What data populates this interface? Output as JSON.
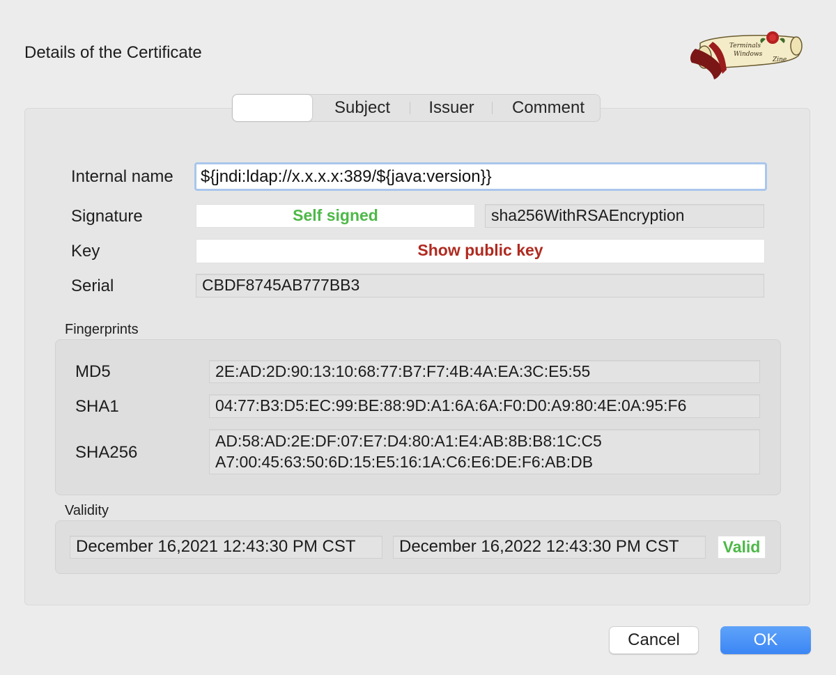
{
  "dialog": {
    "title": "Details of the Certificate"
  },
  "logo": {
    "text_line1": "Terminals",
    "text_line2": "Windows",
    "text_line3": "Zine"
  },
  "tabs": [
    {
      "label": "",
      "active": true
    },
    {
      "label": "Subject",
      "active": false
    },
    {
      "label": "Issuer",
      "active": false
    },
    {
      "label": "Comment",
      "active": false
    }
  ],
  "form": {
    "internal_name_label": "Internal name",
    "internal_name_value": "${jndi:ldap://x.x.x.x:389/${java:version}}",
    "signature_label": "Signature",
    "signature_status": "Self signed",
    "signature_algorithm": "sha256WithRSAEncryption",
    "key_label": "Key",
    "key_button": "Show public key",
    "serial_label": "Serial",
    "serial_value": "CBDF8745AB777BB3"
  },
  "fingerprints": {
    "title": "Fingerprints",
    "md5_label": "MD5",
    "md5_value": "2E:AD:2D:90:13:10:68:77:B7:F7:4B:4A:EA:3C:E5:55",
    "sha1_label": "SHA1",
    "sha1_value": "04:77:B3:D5:EC:99:BE:88:9D:A1:6A:6A:F0:D0:A9:80:4E:0A:95:F6",
    "sha256_label": "SHA256",
    "sha256_line1": "AD:58:AD:2E:DF:07:E7:D4:80:A1:E4:AB:8B:B8:1C:C5",
    "sha256_line2": "A7:00:45:63:50:6D:15:E5:16:1A:C6:E6:DE:F6:AB:DB"
  },
  "validity": {
    "title": "Validity",
    "not_before": "December 16,2021 12:43:30 PM CST",
    "not_after": "December 16,2022 12:43:30 PM CST",
    "status": "Valid"
  },
  "buttons": {
    "cancel": "Cancel",
    "ok": "OK"
  },
  "colors": {
    "valid_green": "#4db848",
    "key_red": "#b02a20",
    "ok_blue": "#3b86f5"
  }
}
